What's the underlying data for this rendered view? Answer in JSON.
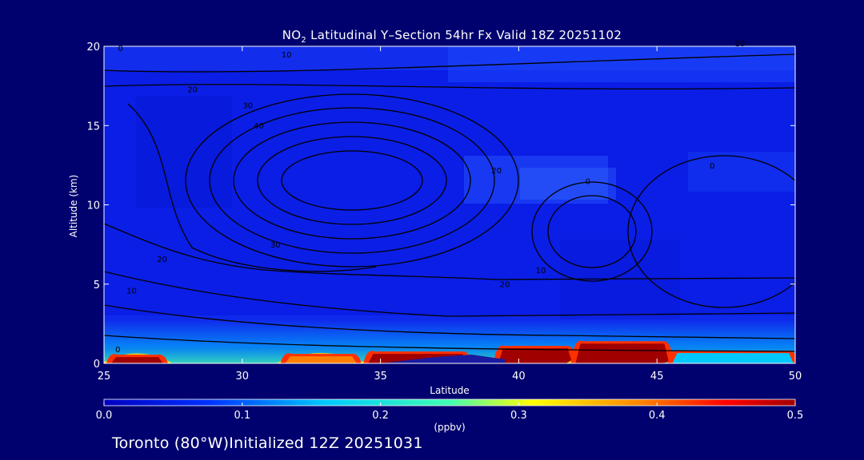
{
  "title": {
    "prefix": "NO",
    "subscript": "2",
    "rest": " Latitudinal Y–Section 54hr  Fx Valid 18Z 20251102"
  },
  "footer": "Toronto (80°W)Initialized 12Z 20251031",
  "colors": {
    "background": "#00006e",
    "field_base": "#0a1ee6",
    "contour": "#000000",
    "high": "#a00000"
  },
  "chart_data": {
    "type": "heatmap",
    "xlabel": "Latitude",
    "ylabel": "Altitude (km)",
    "xlim": [
      25,
      50
    ],
    "ylim": [
      0,
      20
    ],
    "xticks": [
      25,
      30,
      35,
      40,
      45,
      50
    ],
    "yticks": [
      0,
      5,
      10,
      15,
      20
    ],
    "grid": false,
    "colorbar": {
      "units": "(ppbv)",
      "range": [
        0.0,
        0.5
      ],
      "ticks": [
        "0.0",
        "0.1",
        "0.2",
        "0.3",
        "0.4",
        "0.5"
      ],
      "placement": "bottom"
    },
    "high_concentration_regions": [
      {
        "lat_range": [
          25.2,
          27.2
        ],
        "alt_top": 0.55,
        "peak_ppbv": 0.5
      },
      {
        "lat_range": [
          31.5,
          34.2
        ],
        "alt_top": 0.6,
        "peak_ppbv": 0.35
      },
      {
        "lat_range": [
          34.5,
          38.2
        ],
        "alt_top": 0.75,
        "peak_ppbv": 0.5
      },
      {
        "lat_range": [
          39.2,
          42.0
        ],
        "alt_top": 1.1,
        "peak_ppbv": 0.5
      },
      {
        "lat_range": [
          42.0,
          45.5
        ],
        "alt_top": 1.4,
        "peak_ppbv": 0.5
      },
      {
        "lat_range": [
          45.5,
          50.0
        ],
        "alt_top": 0.8,
        "peak_ppbv": 0.2
      }
    ],
    "contour_labels": [
      {
        "text": "0",
        "lat": 25.6,
        "alt": 19.7
      },
      {
        "text": "10",
        "lat": 31.6,
        "alt": 19.3
      },
      {
        "text": "20",
        "lat": 28.2,
        "alt": 17.1
      },
      {
        "text": "30",
        "lat": 30.2,
        "alt": 16.1
      },
      {
        "text": "40",
        "lat": 30.6,
        "alt": 14.8
      },
      {
        "text": "30",
        "lat": 31.2,
        "alt": 7.3
      },
      {
        "text": "20",
        "lat": 27.1,
        "alt": 6.4
      },
      {
        "text": "10",
        "lat": 26.0,
        "alt": 4.4
      },
      {
        "text": "0",
        "lat": 25.5,
        "alt": 0.7
      },
      {
        "text": "0",
        "lat": 42.5,
        "alt": 11.3
      },
      {
        "text": "10",
        "lat": 40.8,
        "alt": 5.7
      },
      {
        "text": "20",
        "lat": 39.5,
        "alt": 4.8
      },
      {
        "text": "20",
        "lat": 39.2,
        "alt": 12.0
      },
      {
        "text": "0",
        "lat": 47.0,
        "alt": 12.3
      },
      {
        "text": "10",
        "lat": 48.0,
        "alt": 20.0
      }
    ]
  }
}
